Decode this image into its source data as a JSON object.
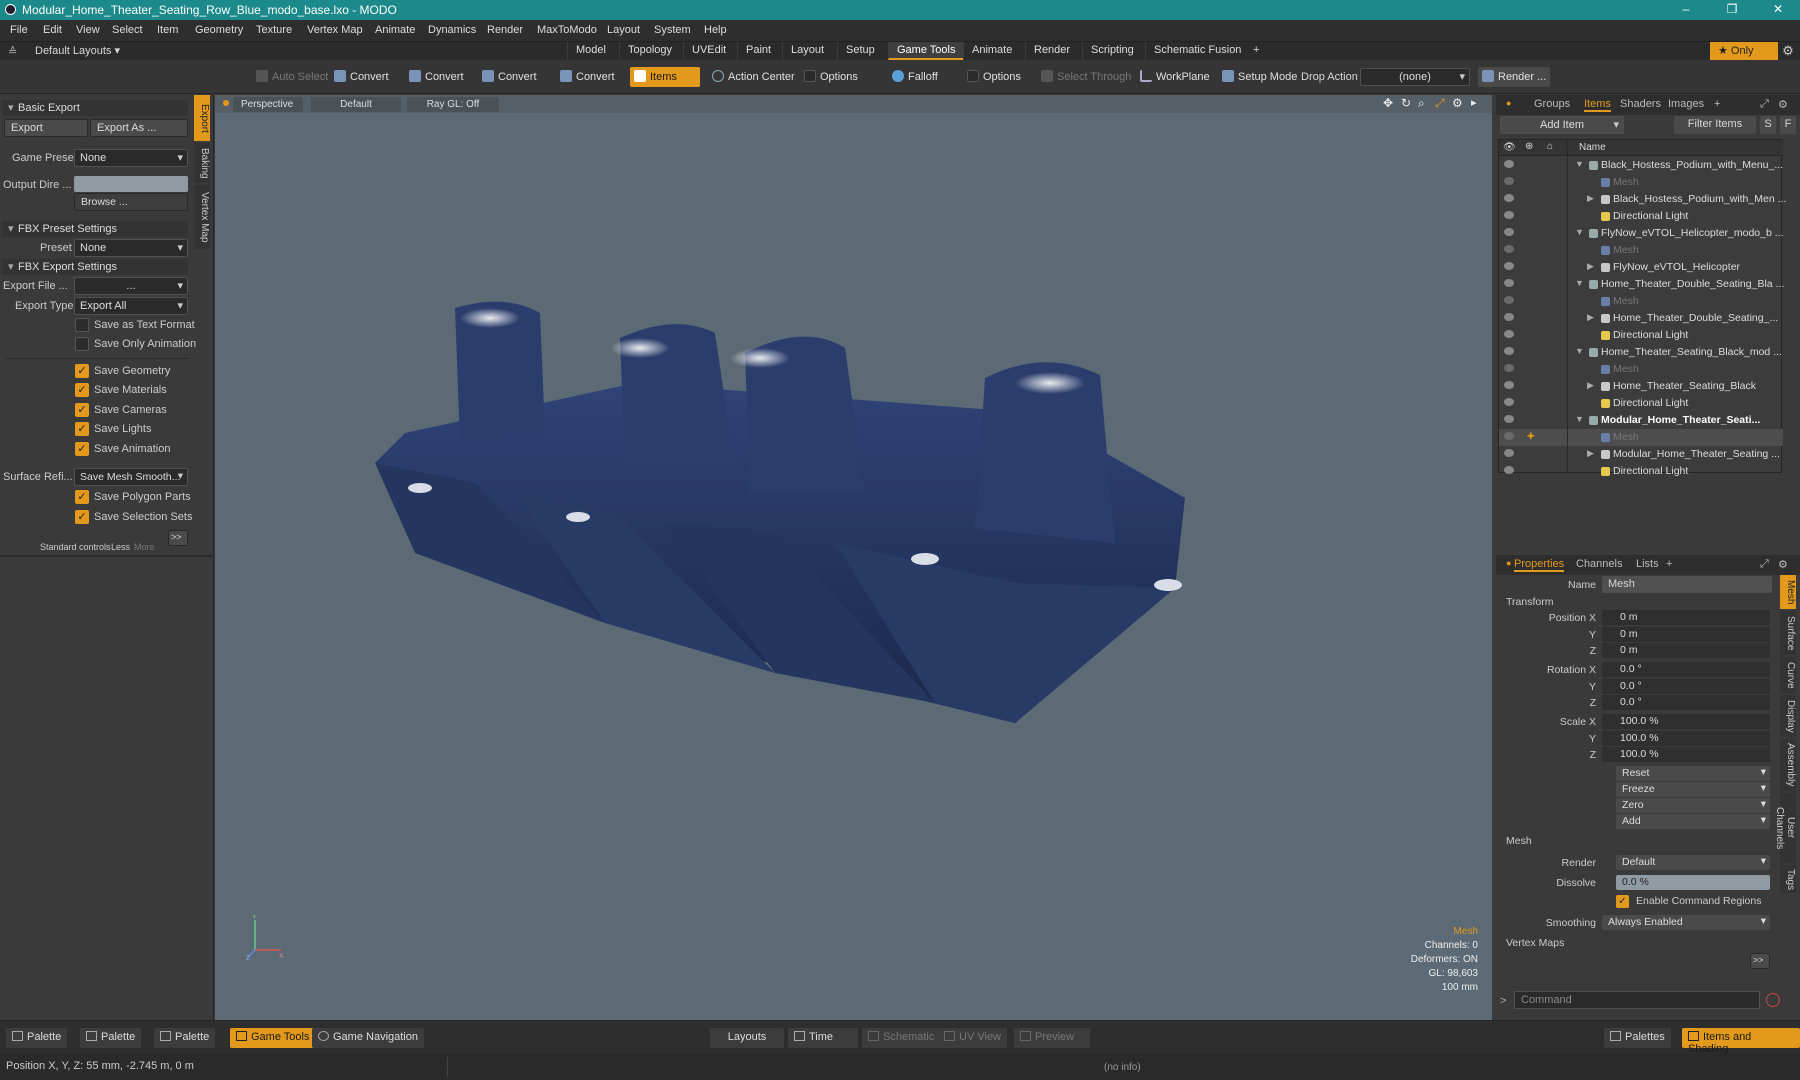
{
  "window": {
    "title": "Modular_Home_Theater_Seating_Row_Blue_modo_base.lxo - MODO",
    "minimize": "–",
    "maximize": "❐",
    "close": "✕"
  },
  "menu": [
    "File",
    "Edit",
    "View",
    "Select",
    "Item",
    "Geometry",
    "Texture",
    "Vertex Map",
    "Animate",
    "Dynamics",
    "Render",
    "MaxToModo",
    "Layout",
    "System",
    "Help"
  ],
  "layout_selector": "Default Layouts ▾",
  "layout_tabs": [
    "Model",
    "Topology",
    "UVEdit",
    "Paint",
    "Layout",
    "Setup",
    "Game Tools",
    "Animate",
    "Render",
    "Scripting",
    "Schematic Fusion",
    "+"
  ],
  "layout_tab_active": "Game Tools",
  "only_label": "★ Only",
  "toolbar": {
    "auto_select": "Auto Select",
    "convert1": "Convert",
    "convert2": "Convert",
    "convert3": "Convert",
    "convert4": "Convert",
    "items": "Items",
    "action_center": "Action Center",
    "options1": "Options",
    "falloff": "Falloff",
    "options2": "Options",
    "select_through": "Select Through",
    "workplane": "WorkPlane",
    "setup_mode": "Setup Mode",
    "drop_action": "Drop Action",
    "drop_value": "(none)",
    "render": "Render ..."
  },
  "left": {
    "basic_export": "Basic Export",
    "export": "Export",
    "export_as": "Export As ...",
    "game_preset_label": "Game Preset",
    "game_preset": "None",
    "output_dir_label": "Output Dire ...",
    "browse": "Browse ...",
    "fbx_preset_settings": "FBX Preset Settings",
    "preset_label": "Preset",
    "preset": "None",
    "fbx_export_settings": "FBX Export Settings",
    "export_file_label": "Export File ...",
    "export_file": "...",
    "export_type_label": "Export Type",
    "export_type": "Export All",
    "save_text": "Save as Text Format",
    "save_anim_only": "Save Only Animation",
    "save_geometry": "Save Geometry",
    "save_materials": "Save Materials",
    "save_cameras": "Save Cameras",
    "save_lights": "Save Lights",
    "save_animation": "Save Animation",
    "surface_label": "Surface Refi...",
    "surface_value": "Save Mesh Smooth...",
    "save_polygon_parts": "Save Polygon Parts",
    "save_selection_sets": "Save Selection Sets",
    "standard_controls": "Standard controls",
    "less": "Less",
    "more": "More",
    "expand": ">>",
    "vtabs": [
      "Export",
      "Baking",
      "Vertex Map"
    ]
  },
  "viewport": {
    "view": "Perspective",
    "shading": "Default",
    "raygl": "Ray GL: Off",
    "info": {
      "type": "Mesh",
      "channels": "Channels: 0",
      "deformers": "Deformers: ON",
      "gl": "GL: 98,603",
      "scale": "100 mm"
    },
    "axis_y": "Y",
    "axis_x": "X",
    "axis_z": "Z"
  },
  "items_panel": {
    "tabs": [
      "Groups",
      "Items",
      "Shaders",
      "Images",
      "+"
    ],
    "active": "Items",
    "add_item": "Add Item",
    "filter_items": "Filter Items",
    "s": "S",
    "f": "F",
    "name_col": "Name",
    "rows": [
      {
        "name": "Black_Hostess_Podium_with_Menu_...",
        "level": 0,
        "kind": "group"
      },
      {
        "name": "Mesh",
        "level": 1,
        "kind": "mesh"
      },
      {
        "name": "Black_Hostess_Podium_with_Men ...",
        "level": 1,
        "kind": "mesh-item"
      },
      {
        "name": "Directional Light",
        "level": 1,
        "kind": "light"
      },
      {
        "name": "FlyNow_eVTOL_Helicopter_modo_b ...",
        "level": 0,
        "kind": "group"
      },
      {
        "name": "Mesh",
        "level": 1,
        "kind": "mesh"
      },
      {
        "name": "FlyNow_eVTOL_Helicopter",
        "level": 1,
        "kind": "mesh-item"
      },
      {
        "name": "Home_Theater_Double_Seating_Bla ...",
        "level": 0,
        "kind": "group"
      },
      {
        "name": "Mesh",
        "level": 1,
        "kind": "mesh"
      },
      {
        "name": "Home_Theater_Double_Seating_...",
        "level": 1,
        "kind": "mesh-item"
      },
      {
        "name": "Directional Light",
        "level": 1,
        "kind": "light"
      },
      {
        "name": "Home_Theater_Seating_Black_mod ...",
        "level": 0,
        "kind": "group"
      },
      {
        "name": "Mesh",
        "level": 1,
        "kind": "mesh"
      },
      {
        "name": "Home_Theater_Seating_Black",
        "level": 1,
        "kind": "mesh-item"
      },
      {
        "name": "Directional Light",
        "level": 1,
        "kind": "light"
      },
      {
        "name": "Modular_Home_Theater_Seati...",
        "level": 0,
        "kind": "group-bold"
      },
      {
        "name": "Mesh",
        "level": 1,
        "kind": "mesh-sel"
      },
      {
        "name": "Modular_Home_Theater_Seating ...",
        "level": 1,
        "kind": "mesh-item"
      },
      {
        "name": "Directional Light",
        "level": 1,
        "kind": "light"
      }
    ]
  },
  "properties": {
    "tabs": [
      "Properties",
      "Channels",
      "Lists",
      "+"
    ],
    "active": "Properties",
    "name_label": "Name",
    "name": "Mesh",
    "transform": "Transform",
    "pos_x_label": "Position X",
    "y": "Y",
    "z": "Z",
    "pos_x": "0 m",
    "pos_y": "0 m",
    "pos_z": "0 m",
    "rot_x_label": "Rotation X",
    "rot_x": "0.0 °",
    "rot_y": "0.0 °",
    "rot_z": "0.0 °",
    "scale_x_label": "Scale X",
    "scale_x": "100.0 %",
    "scale_y": "100.0 %",
    "scale_z": "100.0 %",
    "reset": "Reset",
    "freeze": "Freeze",
    "zero": "Zero",
    "add": "Add",
    "mesh": "Mesh",
    "render_label": "Render",
    "render": "Default",
    "dissolve_label": "Dissolve",
    "dissolve": "0.0 %",
    "enable_cmd": "Enable Command Regions",
    "smoothing_label": "Smoothing",
    "smoothing": "Always Enabled",
    "vertex_maps": "Vertex Maps",
    "expand": ">>",
    "vtabs": [
      "Mesh",
      "Surface",
      "Curve",
      "Display",
      "Assembly",
      "User Channels",
      "Tags"
    ]
  },
  "command_placeholder": "Command",
  "bottom": {
    "palette1": "Palette",
    "palette2": "Palette",
    "palette3": "Palette",
    "game_tools": "Game Tools",
    "game_navigation": "Game Navigation",
    "layouts": "Layouts",
    "time": "Time",
    "schematic": "Schematic",
    "uv_view": "UV View",
    "preview": "Preview",
    "palettes": "Palettes",
    "items_shading": "Items and Shading"
  },
  "status": {
    "position": "Position X, Y, Z:   55 mm, -2.745 m, 0 m",
    "info": "(no info)"
  }
}
